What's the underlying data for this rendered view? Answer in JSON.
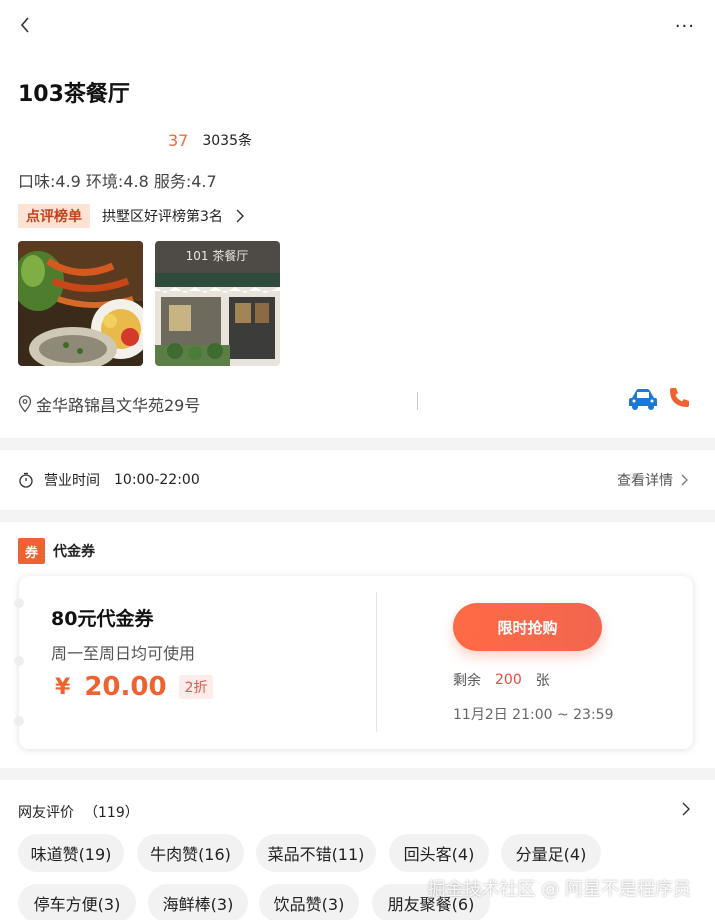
{
  "header": {
    "title": "103茶餐厅"
  },
  "rating": {
    "score": "37",
    "count": "3035条"
  },
  "scores": "口味:4.9 环境:4.8 服务:4.7",
  "rank": {
    "badge": "点评榜单",
    "text": "拱墅区好评榜第3名"
  },
  "photos": [
    {
      "name": "dish-photo",
      "sign": ""
    },
    {
      "name": "storefront-photo",
      "sign": "101 茶餐厅"
    }
  ],
  "address": "金华路锦昌文华苑29号",
  "hours": {
    "label": "营业时间",
    "time": "10:00-22:00",
    "detail": "查看详情"
  },
  "coupon_section": {
    "mark": "券",
    "title": "代金券",
    "card": {
      "name": "80元代金券",
      "desc": "周一至周日均可使用",
      "yen": "¥",
      "price": "20.00",
      "discount": "2折",
      "button": "限时抢购",
      "remain_prefix": "剩余",
      "remain_num": "200",
      "remain_suffix": "张",
      "valid": "11月2日 21:00 ~ 23:59"
    }
  },
  "reviews": {
    "title": "网友评价",
    "count": "（119）",
    "tags": [
      "味道赞(19)",
      "牛肉赞(16)",
      "菜品不错(11)",
      "回头客(4)",
      "分量足(4)",
      "停车方便(3)",
      "海鲜棒(3)",
      "饮品赞(3)",
      "朋友聚餐(6)"
    ]
  },
  "watermark": "掘金技术社区 @ 阿星不是程序员",
  "colors": {
    "accent": "#f0622f",
    "rank_bg": "#fde3d3",
    "car": "#1a78d6"
  }
}
